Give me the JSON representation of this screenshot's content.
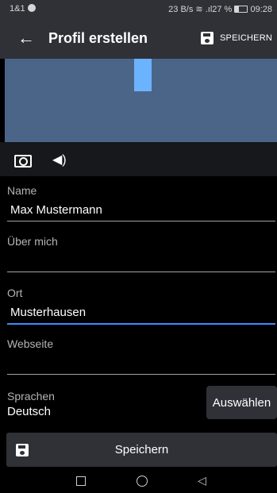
{
  "status_bar": {
    "carrier": "1&1",
    "speed": "23 B/s",
    "battery": "27 %",
    "time": "09:28"
  },
  "app_bar": {
    "title": "Profil erstellen",
    "save_label": "SPEICHERN"
  },
  "fields": {
    "name": {
      "label": "Name",
      "value": "Max Mustermann"
    },
    "about": {
      "label": "Über mich",
      "value": ""
    },
    "city": {
      "label": "Ort",
      "value": "Musterhausen"
    },
    "website": {
      "label": "Webseite",
      "value": ""
    }
  },
  "languages": {
    "label": "Sprachen",
    "value": "Deutsch",
    "choose_label": "Auswählen"
  },
  "bottom_button": {
    "label": "Speichern"
  },
  "colors": {
    "toolbar": "#2f3137",
    "cover": "#4b6588",
    "accent": "#3d8cff"
  }
}
